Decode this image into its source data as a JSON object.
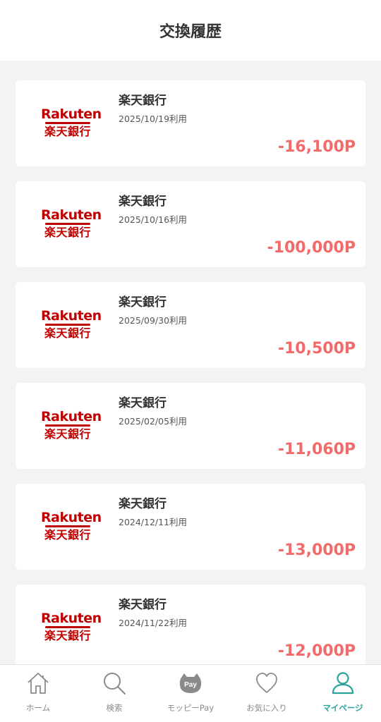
{
  "header": {
    "title": "交換履歴"
  },
  "history": [
    {
      "logo_en": "Rakuten",
      "logo_jp": "楽天銀行",
      "name": "楽天銀行",
      "date": "2025/10/19利用",
      "amount": "-16,100P"
    },
    {
      "logo_en": "Rakuten",
      "logo_jp": "楽天銀行",
      "name": "楽天銀行",
      "date": "2025/10/16利用",
      "amount": "-100,000P"
    },
    {
      "logo_en": "Rakuten",
      "logo_jp": "楽天銀行",
      "name": "楽天銀行",
      "date": "2025/09/30利用",
      "amount": "-10,500P"
    },
    {
      "logo_en": "Rakuten",
      "logo_jp": "楽天銀行",
      "name": "楽天銀行",
      "date": "2025/02/05利用",
      "amount": "-11,060P"
    },
    {
      "logo_en": "Rakuten",
      "logo_jp": "楽天銀行",
      "name": "楽天銀行",
      "date": "2024/12/11利用",
      "amount": "-13,000P"
    },
    {
      "logo_en": "Rakuten",
      "logo_jp": "楽天銀行",
      "name": "楽天銀行",
      "date": "2024/11/22利用",
      "amount": "-12,000P"
    }
  ],
  "tabbar": {
    "items": [
      {
        "label": "ホーム",
        "icon": "home-icon",
        "active": false
      },
      {
        "label": "検索",
        "icon": "search-icon",
        "active": false
      },
      {
        "label": "モッピーPay",
        "icon": "pay-icon",
        "icon_text": "Pay",
        "active": false
      },
      {
        "label": "お気に入り",
        "icon": "heart-icon",
        "active": false
      },
      {
        "label": "マイページ",
        "icon": "user-icon",
        "active": true
      }
    ]
  },
  "colors": {
    "amount": "#f26a6a",
    "brand_red": "#bf0000",
    "active_tab": "#2aa39a",
    "inactive_tab": "#8a8a8a"
  }
}
